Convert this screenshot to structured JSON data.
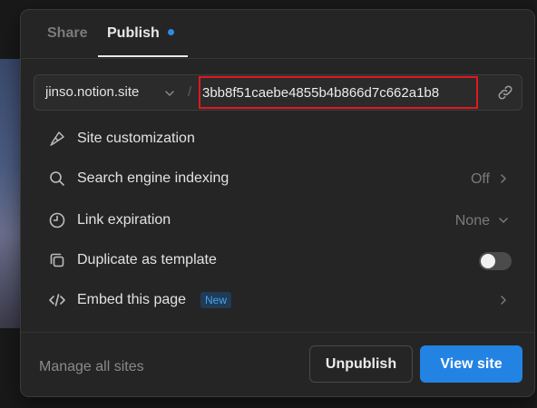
{
  "tabs": [
    {
      "label": "Share",
      "active": false
    },
    {
      "label": "Publish",
      "active": true
    }
  ],
  "url": {
    "domain": "jinso.notion.site",
    "separator": "/",
    "slug": "3bb8f51caebe4855b4b866d7c662a1b8"
  },
  "options": [
    {
      "label": "Site customization",
      "icon": "brush-icon"
    },
    {
      "label": "Search engine indexing",
      "value": "Off",
      "icon": "search-icon",
      "trailing": "chevron-right-icon"
    },
    {
      "label": "Link expiration",
      "value": "None",
      "icon": "clock-icon",
      "trailing": "chevron-down-icon"
    },
    {
      "label": "Duplicate as template",
      "icon": "duplicate-icon",
      "toggle": false
    },
    {
      "label": "Embed this page",
      "badge": "New",
      "icon": "code-icon",
      "trailing": "chevron-right-icon"
    }
  ],
  "footer": {
    "manage_label": "Manage all sites",
    "unpublish_label": "Unpublish",
    "view_label": "View site"
  },
  "colors": {
    "accent": "#2383e2",
    "highlight_border": "#e0181f",
    "background": "#252525"
  }
}
